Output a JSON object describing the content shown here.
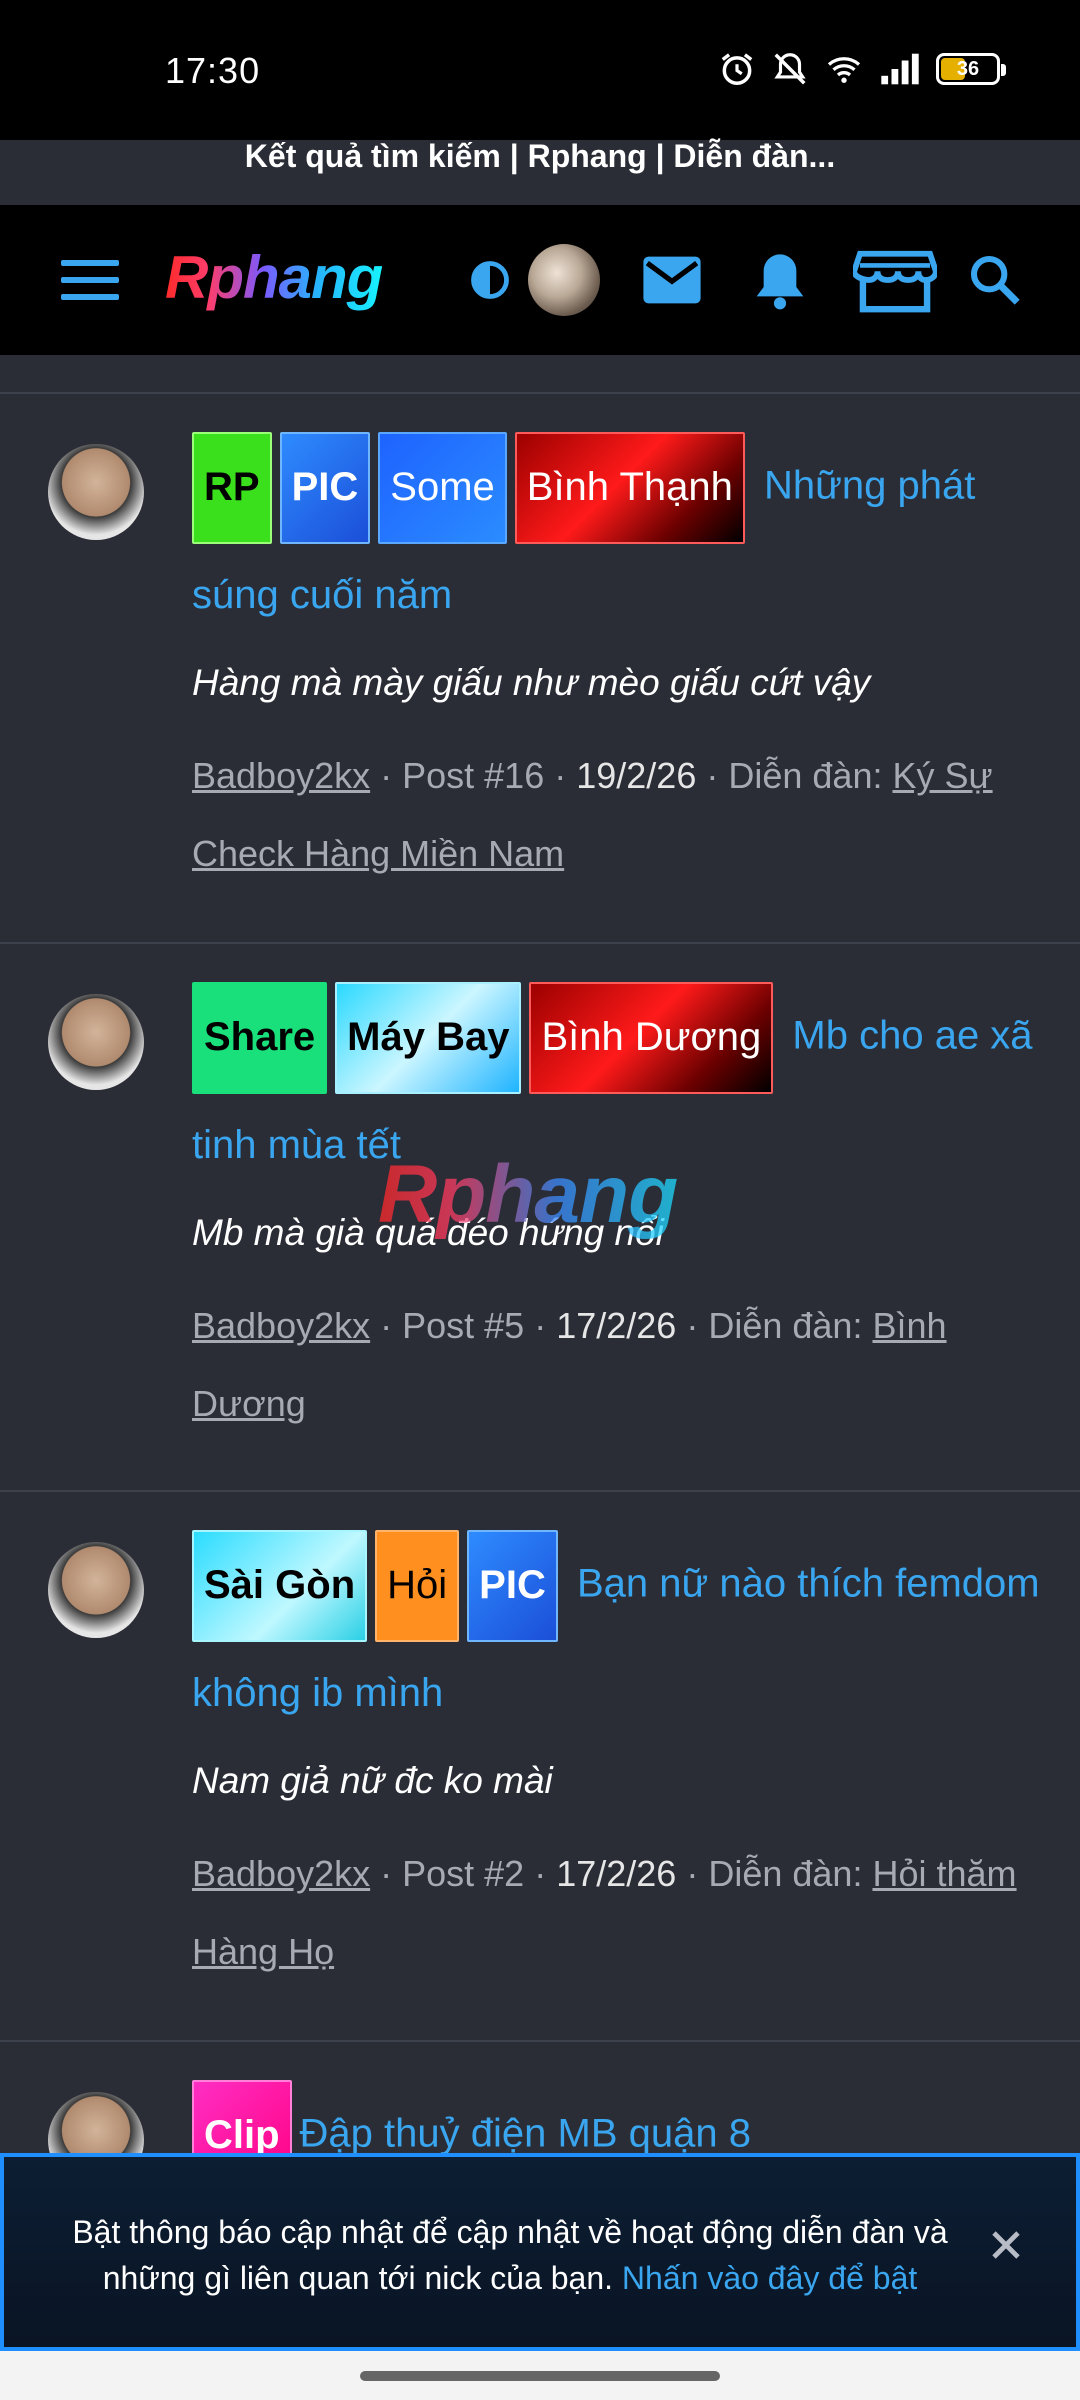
{
  "status": {
    "time": "17:30",
    "battery": "36"
  },
  "page_title": "Kết quả tìm kiếm | Rphang | Diễn đàn...",
  "nav": {
    "logo": "Rphang"
  },
  "results": [
    {
      "tags": [
        "RP",
        "PIC",
        "Some",
        "Bình Thạnh"
      ],
      "title": "Những phát súng cuối năm",
      "snippet": "Hàng mà mày giấu như mèo giấu cứt vậy",
      "author": "Badboy2kx",
      "post": "Post #16",
      "date": "19/2/26",
      "forum_label": "Diễn đàn:",
      "forum": "Ký Sự Check Hàng Miền Nam"
    },
    {
      "tags": [
        "Share",
        "Máy Bay",
        "Bình Dương"
      ],
      "title": "Mb cho ae xã tinh mùa tết",
      "snippet": "Mb mà già quá đéo hứng nổi",
      "author": "Badboy2kx",
      "post": "Post #5",
      "date": "17/2/26",
      "forum_label": "Diễn đàn:",
      "forum": "Bình Dương"
    },
    {
      "tags": [
        "Sài Gòn",
        "Hỏi",
        "PIC"
      ],
      "title": "Bạn nữ nào thích femdom không ib mình",
      "snippet": "Nam giả nữ đc ko mài",
      "author": "Badboy2kx",
      "post": "Post #2",
      "date": "17/2/26",
      "forum_label": "Diễn đàn:",
      "forum": "Hỏi thăm Hàng Họ"
    },
    {
      "tags": [
        "Clip"
      ],
      "title": "Đập thuỷ điện MB quận 8"
    }
  ],
  "watermark": "Rphang",
  "notice": {
    "text": "Bật thông báo cập nhật để cập nhật về hoạt động diễn đàn và những gì liên quan tới nick của bạn.",
    "link": "Nhấn vào đây để bật"
  },
  "colors": {
    "link": "#3aa6f0",
    "background": "#2a2d36",
    "nav": "#000000"
  }
}
